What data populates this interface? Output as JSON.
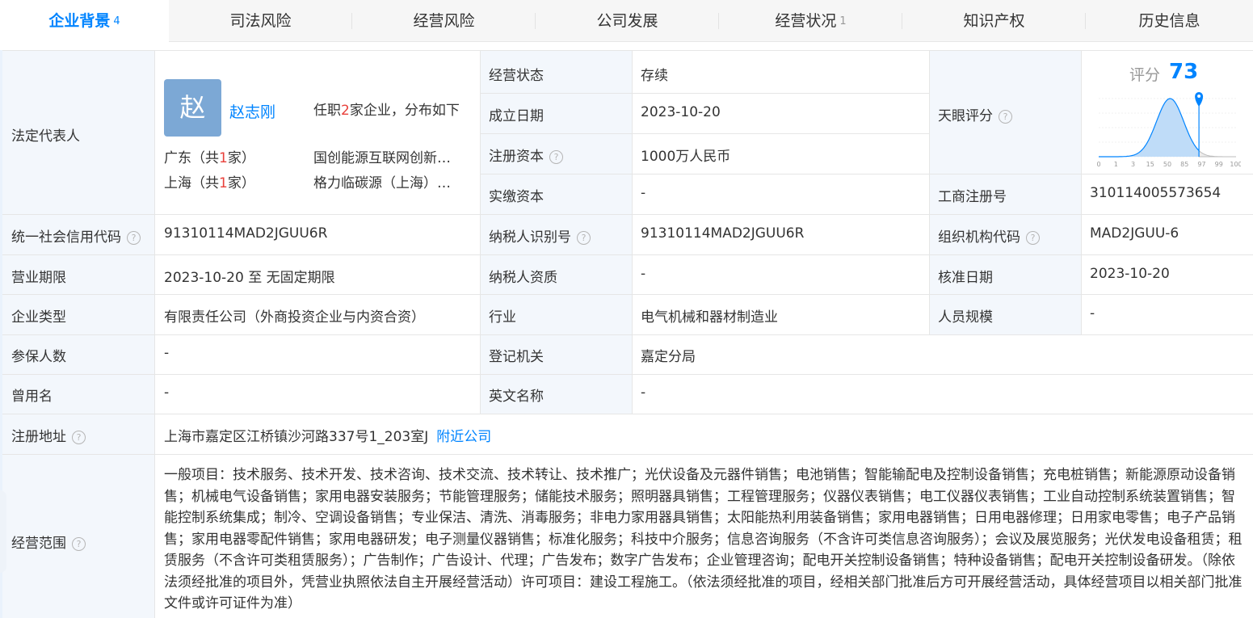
{
  "tabs": [
    {
      "label": "企业背景",
      "count": "4"
    },
    {
      "label": "司法风险",
      "count": ""
    },
    {
      "label": "经营风险",
      "count": ""
    },
    {
      "label": "公司发展",
      "count": ""
    },
    {
      "label": "经营状况",
      "count": "1"
    },
    {
      "label": "知识产权",
      "count": ""
    },
    {
      "label": "历史信息",
      "count": ""
    }
  ],
  "legal_rep": {
    "label": "法定代表人",
    "avatar_char": "赵",
    "name": "赵志刚",
    "positions_pre": "任职",
    "positions_count": "2",
    "positions_post": "家企业，分布如下",
    "regions": [
      {
        "pre": "广东（共",
        "count": "1",
        "post": "家）",
        "company": "国创能源互联网创新…"
      },
      {
        "pre": "上海（共",
        "count": "1",
        "post": "家）",
        "company": "格力临碳源（上海）…"
      }
    ]
  },
  "fields": {
    "status_label": "经营状态",
    "status_value": "存续",
    "founded_label": "成立日期",
    "founded_value": "2023-10-20",
    "reg_capital_label": "注册资本",
    "reg_capital_value": "1000万人民币",
    "paid_capital_label": "实缴资本",
    "paid_capital_value": "-",
    "tianyan_label": "天眼评分",
    "bizreg_label": "工商注册号",
    "bizreg_value": "310114005573654",
    "credit_code_label": "统一社会信用代码",
    "credit_code_value": "91310114MAD2JGUU6R",
    "taxpayer_id_label": "纳税人识别号",
    "taxpayer_id_value": "91310114MAD2JGUU6R",
    "org_code_label": "组织机构代码",
    "org_code_value": "MAD2JGUU-6",
    "term_label": "营业期限",
    "term_value": "2023-10-20 至 无固定期限",
    "taxpayer_qual_label": "纳税人资质",
    "taxpayer_qual_value": "-",
    "approval_label": "核准日期",
    "approval_value": "2023-10-20",
    "type_label": "企业类型",
    "type_value": "有限责任公司（外商投资企业与内资合资）",
    "industry_label": "行业",
    "industry_value": "电气机械和器材制造业",
    "staff_label": "人员规模",
    "staff_value": "-",
    "insured_label": "参保人数",
    "insured_value": "-",
    "authority_label": "登记机关",
    "authority_value": "嘉定分局",
    "former_label": "曾用名",
    "former_value": "-",
    "english_label": "英文名称",
    "english_value": "-",
    "address_label": "注册地址",
    "address_value": "上海市嘉定区江桥镇沙河路337号1_203室J",
    "nearby_link": "附近公司",
    "scope_label": "经营范围",
    "scope_value": "一般项目：技术服务、技术开发、技术咨询、技术交流、技术转让、技术推广；光伏设备及元器件销售；电池销售；智能输配电及控制设备销售；充电桩销售；新能源原动设备销售；机械电气设备销售；家用电器安装服务；节能管理服务；储能技术服务；照明器具销售；工程管理服务；仪器仪表销售；电工仪器仪表销售；工业自动控制系统装置销售；智能控制系统集成；制冷、空调设备销售；专业保洁、清洗、消毒服务；非电力家用器具销售；太阳能热利用装备销售；家用电器销售；日用电器修理；日用家电零售；电子产品销售；家用电器零配件销售；家用电器研发；电子测量仪器销售；标准化服务；科技中介服务；信息咨询服务（不含许可类信息咨询服务）；会议及展览服务；光伏发电设备租赁；租赁服务（不含许可类租赁服务）；广告制作；广告设计、代理；广告发布；数字广告发布；企业管理咨询；配电开关控制设备销售；特种设备销售；配电开关控制设备研发。（除依法须经批准的项目外，凭营业执照依法自主开展经营活动）许可项目：建设工程施工。（依法须经批准的项目，经相关部门批准后方可开展经营活动，具体经营项目以相关部门批准文件或许可证件为准）"
  },
  "score": {
    "label": "评分",
    "value": "73",
    "value_num": 73,
    "ticks": [
      "0",
      "1",
      "3",
      "15",
      "50",
      "85",
      "97",
      "99",
      "100"
    ],
    "accent": "#0084ff"
  },
  "colors": {
    "accent": "#0084ff",
    "label_bg": "#f3f7fc",
    "red": "#e8413b"
  }
}
